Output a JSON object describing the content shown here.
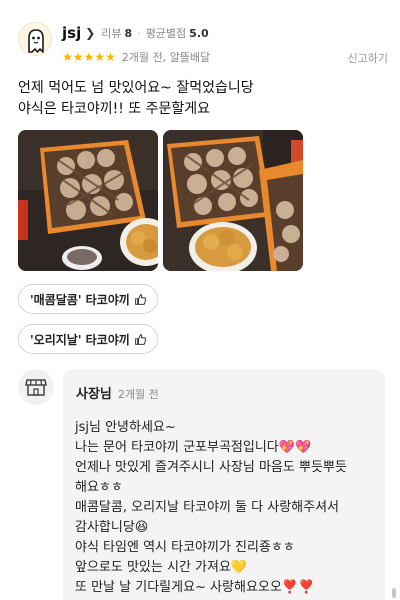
{
  "review": {
    "nickname": "jsj",
    "review_count_label": "리뷰",
    "review_count": "8",
    "avg_rating_label": "평균별점",
    "avg_rating": "5.0",
    "stars": "★★★★★",
    "rating": 5,
    "time_ago": "2개월 전, 알뜰배달",
    "report_label": "신고하기",
    "text_lines": [
      "언제 먹어도 넘 맛있어요~ 잘먹었습니당",
      "야식은 타코야끼!! 또 주문할게요"
    ],
    "menu_tags": [
      "'매콤달콤' 타코야끼",
      "'오리지날' 타코야끼"
    ]
  },
  "owner_reply": {
    "name": "사장님",
    "time_ago": "2개월 전",
    "lines": [
      "jsj님 안녕하세요~",
      "나는 문어 타코야끼 군포부곡점입니다💖💖",
      "언제나 맛있게 즐겨주시니 사장님 마음도 뿌듯뿌듯",
      "해요ㅎㅎ",
      "매콤달콤, 오리지날 타코야끼 둘 다 사랑해주셔서",
      "감사합니당😆",
      "야식 타임엔 역시 타코야끼가 진리죵ㅎㅎ",
      "앞으로도 맛있는 시간 가져요💛",
      "또 만날 날 기다릴게요~ 사랑해요오오❣️❣️"
    ]
  },
  "colors": {
    "star": "#ffb400",
    "owner_bg": "#f4f4f5",
    "accent": "#f07a2b"
  },
  "icons": {
    "avatar": "ghost-avatar-icon",
    "chevron": "chevron-right-icon",
    "thumb": "thumbs-up-icon",
    "store": "store-icon"
  }
}
